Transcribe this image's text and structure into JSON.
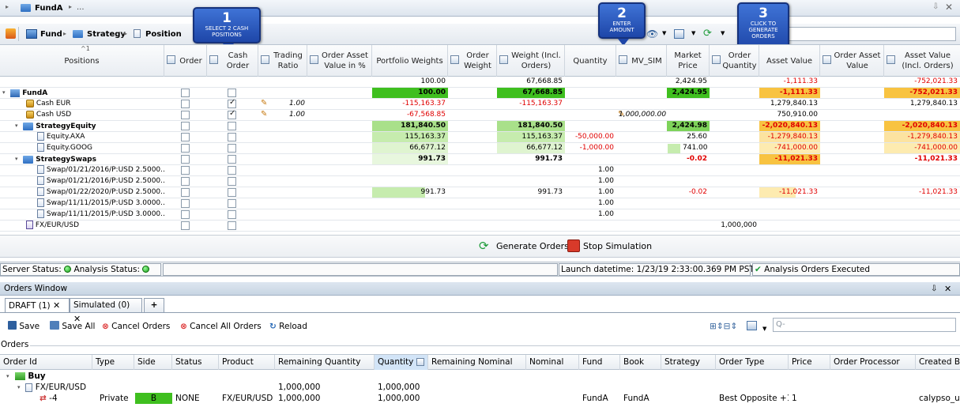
{
  "top": {
    "breadcrumb_root": "FundA",
    "breadcrumb_more": "..."
  },
  "toolbar": {
    "fund": "Fund",
    "strategy": "Strategy",
    "position": "Position"
  },
  "callouts": [
    {
      "num": "1",
      "text": "SELECT 2 CASH POSITIONS"
    },
    {
      "num": "2",
      "text": "ENTER AMOUNT"
    },
    {
      "num": "3",
      "text": "CLICK TO GENERATE ORDERS"
    }
  ],
  "grid": {
    "sort_indicator": "1",
    "headers": {
      "positions": "Positions",
      "order": "Order",
      "cash_order": "Cash Order",
      "trading_ratio": "Trading Ratio",
      "order_asset_pct": "Order Asset Value in %",
      "portfolio_weights": "Portfolio Weights",
      "order_weight": "Order Weight",
      "weight_incl": "Weight (Incl. Orders)",
      "quantity": "Quantity",
      "mv_sim": "MV_SIM",
      "market_price": "Market Price",
      "order_quantity": "Order Quantity",
      "asset_value": "Asset Value",
      "order_asset_value": "Order Asset Value",
      "asset_value_incl": "Asset Value (Incl. Orders)"
    },
    "totals": {
      "pw": "100.00",
      "wi": "67,668.85",
      "mp": "2,424.95",
      "av": "-1,111.33",
      "avi": "-752,021.33"
    },
    "rows": [
      {
        "name": "FundA",
        "pw": "100.00",
        "wi": "67,668.85",
        "mp": "2,424.95",
        "av": "-1,111.33",
        "avi": "-752,021.33"
      },
      {
        "name": "Cash EUR",
        "tr": "1.00",
        "pw": "-115,163.37",
        "wi": "-115,163.37",
        "av": "1,279,840.13",
        "avi": "1,279,840.13"
      },
      {
        "name": "Cash USD",
        "tr": "1.00",
        "pw": "-67,568.85",
        "mv": "1,000,000.00",
        "av": "750,910.00"
      },
      {
        "name": "StrategyEquity",
        "pw": "181,840.50",
        "wi": "181,840.50",
        "mp": "2,424.98",
        "av": "-2,020,840.13",
        "avi": "-2,020,840.13"
      },
      {
        "name": "Equity.AXA",
        "pw": "115,163.37",
        "wi": "115,163.37",
        "qty": "-50,000.00",
        "mp": "25.60",
        "av": "-1,279,840.13",
        "avi": "-1,279,840.13"
      },
      {
        "name": "Equity.GOOG",
        "pw": "66,677.12",
        "wi": "66,677.12",
        "qty": "-1,000.00",
        "mp": "741.00",
        "av": "-741,000.00",
        "avi": "-741,000.00"
      },
      {
        "name": "StrategySwaps",
        "pw": "991.73",
        "wi": "991.73",
        "mp": "-0.02",
        "av": "-11,021.33",
        "avi": "-11,021.33"
      },
      {
        "name": "Swap/01/21/2016/P:USD 2.5000...",
        "qty": "1.00"
      },
      {
        "name": "Swap/01/21/2016/P:USD 2.5000...",
        "qty": "1.00"
      },
      {
        "name": "Swap/01/22/2020/P:USD 2.5000...",
        "pw": "991.73",
        "wi": "991.73",
        "qty": "1.00",
        "mp": "-0.02",
        "av": "-11,021.33",
        "avi": "-11,021.33"
      },
      {
        "name": "Swap/11/11/2015/P:USD 3.0000...",
        "qty": "1.00"
      },
      {
        "name": "Swap/11/11/2015/P:USD 3.0000...",
        "qty": "1.00"
      },
      {
        "name": "FX/EUR/USD",
        "oq": "1,000,000"
      }
    ]
  },
  "actions": {
    "generate": "Generate Orders",
    "stop": "Stop Simulation"
  },
  "status": {
    "server": "Server Status:",
    "analysis": "Analysis Status:",
    "launch": "Launch datetime: 1/23/19 2:33:00.369 PM PST",
    "executed": "Analysis Orders Executed"
  },
  "orders_window": {
    "title": "Orders Window",
    "tabs": [
      {
        "label": "DRAFT (1)"
      },
      {
        "label": "Simulated (0)"
      }
    ],
    "add_tab": "+",
    "buttons": {
      "save": "Save",
      "save_all": "Save All",
      "cancel": "Cancel Orders",
      "cancel_all": "Cancel All Orders",
      "reload": "Reload"
    },
    "search_placeholder": "Q-",
    "section": "Orders",
    "columns": [
      "Order Id",
      "Type",
      "Side",
      "Status",
      "Product",
      "Remaining Quantity",
      "Quantity",
      "Remaining Nominal",
      "Nominal",
      "Fund",
      "Book",
      "Strategy",
      "Order Type",
      "Price",
      "Order Processor",
      "Created B"
    ],
    "group": "Buy",
    "product_row": {
      "name": "FX/EUR/USD",
      "remaining": "1,000,000",
      "quantity": "1,000,000"
    },
    "order_row": {
      "id": "-4",
      "type": "Private",
      "side": "B",
      "status": "NONE",
      "product": "FX/EUR/USD",
      "remaining": "1,000,000",
      "quantity": "1,000,000",
      "fund": "FundA",
      "book": "FundA",
      "order_type": "Best Opposite +1",
      "price": "1",
      "created": "calypso_u:"
    }
  },
  "colors": {
    "green_strong": "#3fbf1f",
    "green_light": "#c6ecae",
    "yellow": "#f8c341",
    "yellow_light": "#fdebb0",
    "negative": "#e00000",
    "callout": "#2a5bc4"
  }
}
